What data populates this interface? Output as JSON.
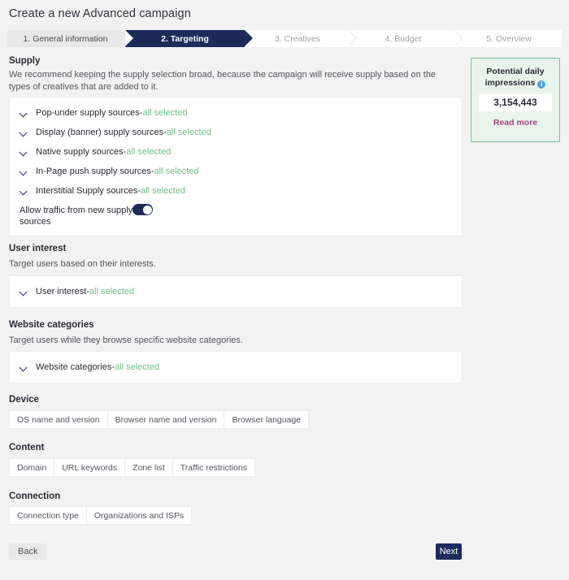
{
  "page_title": "Create a new Advanced campaign",
  "stepper": {
    "steps": [
      {
        "label": "1. General information",
        "state": "completed"
      },
      {
        "label": "2. Targeting",
        "state": "active"
      },
      {
        "label": "3. Creatives",
        "state": "upcoming"
      },
      {
        "label": "4. Budget",
        "state": "upcoming"
      },
      {
        "label": "5. Overview",
        "state": "upcoming"
      }
    ]
  },
  "supply": {
    "title": "Supply",
    "description": "We recommend keeping the supply selection broad, because the campaign will receive supply based on the types of creatives that are added to it.",
    "rows": [
      {
        "label": "Pop-under supply sources",
        "separator": " - ",
        "status": "all selected"
      },
      {
        "label": "Display (banner) supply sources",
        "separator": " - ",
        "status": "all selected"
      },
      {
        "label": "Native supply sources",
        "separator": " - ",
        "status": "all selected"
      },
      {
        "label": "In-Page push supply sources",
        "separator": " - ",
        "status": "all selected"
      },
      {
        "label": "Interstitial Supply sources",
        "separator": " - ",
        "status": "all selected"
      }
    ],
    "toggle": {
      "label": "Allow traffic from new supply sources",
      "state": "on"
    }
  },
  "user_interest": {
    "title": "User interest",
    "description": "Target users based on their interests.",
    "row": {
      "label": "User interest",
      "separator": " - ",
      "status": "all selected"
    }
  },
  "website_categories": {
    "title": "Website categories",
    "description": "Target users while they browse specific website categories.",
    "row": {
      "label": "Website categories",
      "separator": " - ",
      "status": "all selected"
    }
  },
  "device": {
    "title": "Device",
    "chips": [
      "OS name and version",
      "Browser name and version",
      "Browser language"
    ]
  },
  "content": {
    "title": "Content",
    "chips": [
      "Domain",
      "URL keywords",
      "Zone list",
      "Traffic restrictions"
    ]
  },
  "connection": {
    "title": "Connection",
    "chips": [
      "Connection type",
      "Organizations and ISPs"
    ]
  },
  "sidebar": {
    "title": "Potential daily impressions",
    "info_icon": "info-icon",
    "value": "3,154,443",
    "read_more": "Read more"
  },
  "footer": {
    "back": "Back",
    "next": "Next"
  },
  "colors": {
    "accent_navy": "#1e2a5a",
    "status_green": "#6ec08a",
    "card_green_border": "#7cbf93",
    "card_green_bg": "#e9f4ec",
    "link_purple": "#a4477f",
    "info_blue": "#54a0dd",
    "page_bg": "#f2f2f2"
  }
}
